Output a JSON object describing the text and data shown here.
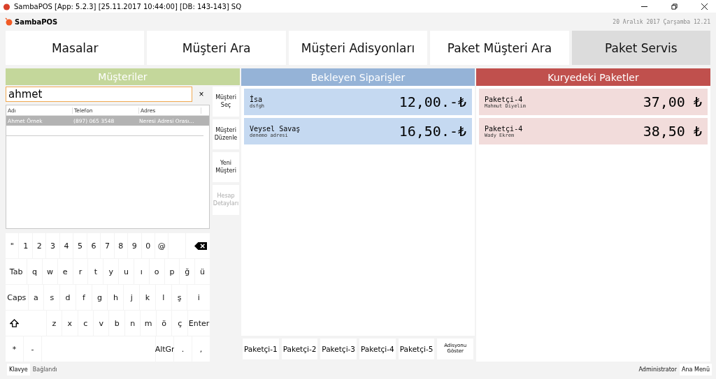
{
  "window": {
    "title": "SambaPOS [App: 5.2.3] [25.11.2017 10:44:00] [DB: 143-143] SQ"
  },
  "header": {
    "logo": "SambaPOS",
    "date": "20 Aralık 2017 Çarşamba 12.21"
  },
  "nav": [
    {
      "label": "Masalar",
      "selected": false
    },
    {
      "label": "Müşteri Ara",
      "selected": false
    },
    {
      "label": "Müşteri Adisyonları",
      "selected": false
    },
    {
      "label": "Paket Müşteri Ara",
      "selected": false
    },
    {
      "label": "Paket Servis",
      "selected": true
    }
  ],
  "customers": {
    "title": "Müşteriler",
    "search": {
      "value": "ahmet",
      "clear": "×"
    },
    "columns": [
      "Adı",
      "Telefon",
      "Adres"
    ],
    "rows": [
      {
        "cells": [
          "Ahmet Örnek",
          "(897) 065 3548",
          "Neresi Adresi Orası..."
        ],
        "selected": true
      }
    ],
    "actions": [
      {
        "label": "Müşteri Seç",
        "disabled": false
      },
      {
        "label": "Müşteri Düzenle",
        "disabled": false
      },
      {
        "label": "Yeni Müşteri",
        "disabled": false
      },
      {
        "label": "Hesap Detayları",
        "disabled": true
      }
    ],
    "keyboard": [
      [
        {
          "kind": "key",
          "label": "\""
        },
        {
          "kind": "key",
          "label": "1"
        },
        {
          "kind": "key",
          "label": "2"
        },
        {
          "kind": "key",
          "label": "3"
        },
        {
          "kind": "key",
          "label": "4"
        },
        {
          "kind": "key",
          "label": "5"
        },
        {
          "kind": "key",
          "label": "6"
        },
        {
          "kind": "key",
          "label": "7"
        },
        {
          "kind": "key",
          "label": "8"
        },
        {
          "kind": "key",
          "label": "9"
        },
        {
          "kind": "key",
          "label": "0"
        },
        {
          "kind": "key",
          "label": "@"
        },
        {
          "kind": "blank"
        },
        {
          "kind": "backspace"
        }
      ],
      [
        {
          "kind": "wide",
          "label": "Tab"
        },
        {
          "kind": "key",
          "label": "q"
        },
        {
          "kind": "key",
          "label": "w"
        },
        {
          "kind": "key",
          "label": "e"
        },
        {
          "kind": "key",
          "label": "r"
        },
        {
          "kind": "key",
          "label": "t"
        },
        {
          "kind": "key",
          "label": "y"
        },
        {
          "kind": "key",
          "label": "u"
        },
        {
          "kind": "key",
          "label": "ı"
        },
        {
          "kind": "key",
          "label": "o"
        },
        {
          "kind": "key",
          "label": "p"
        },
        {
          "kind": "key",
          "label": "ğ"
        },
        {
          "kind": "key",
          "label": "ü"
        }
      ],
      [
        {
          "kind": "wide",
          "label": "Caps"
        },
        {
          "kind": "key",
          "label": "a"
        },
        {
          "kind": "key",
          "label": "s"
        },
        {
          "kind": "key",
          "label": "d"
        },
        {
          "kind": "key",
          "label": "f"
        },
        {
          "kind": "key",
          "label": "g"
        },
        {
          "kind": "key",
          "label": "h"
        },
        {
          "kind": "key",
          "label": "j"
        },
        {
          "kind": "key",
          "label": "k"
        },
        {
          "kind": "key",
          "label": "l"
        },
        {
          "kind": "key",
          "label": "ş"
        },
        {
          "kind": "wide",
          "label": "i"
        }
      ],
      [
        {
          "kind": "shift"
        },
        {
          "kind": "key",
          "label": "z"
        },
        {
          "kind": "key",
          "label": "x"
        },
        {
          "kind": "key",
          "label": "c"
        },
        {
          "kind": "key",
          "label": "v"
        },
        {
          "kind": "key",
          "label": "b"
        },
        {
          "kind": "key",
          "label": "n"
        },
        {
          "kind": "key",
          "label": "m"
        },
        {
          "kind": "key",
          "label": "ö"
        },
        {
          "kind": "key",
          "label": "ç"
        },
        {
          "kind": "wide",
          "label": "Enter"
        }
      ],
      [
        {
          "kind": "key",
          "label": "*"
        },
        {
          "kind": "key",
          "label": "-"
        },
        {
          "kind": "space"
        },
        {
          "kind": "key",
          "label": "AltGr"
        },
        {
          "kind": "key",
          "label": "."
        },
        {
          "kind": "key",
          "label": ","
        }
      ]
    ]
  },
  "waiting": {
    "title": "Bekleyen Siparişler",
    "orders": [
      {
        "name": "İsa",
        "address": "dsfgh",
        "amount": "12,00.-₺"
      },
      {
        "name": "Veysel Savaş",
        "address": "denemo adresi",
        "amount": "16,50.-₺"
      }
    ],
    "couriers": [
      "Paketçi-1",
      "Paketçi-2",
      "Paketçi-3",
      "Paketçi-4",
      "Paketçi-5"
    ],
    "show_button": "Adisyonu Göster"
  },
  "delivering": {
    "title": "Kuryedeki Paketler",
    "orders": [
      {
        "name": "Paketçi-4",
        "address": "Mahmut Diyelim",
        "amount": "37,00 ₺"
      },
      {
        "name": "Paketçi-4",
        "address": "Wady Ekrem",
        "amount": "38,50 ₺"
      }
    ]
  },
  "status_bar": {
    "keyboard_button": "Klavye",
    "connection": "Bağlandı",
    "user": "Administrator",
    "menu_button": "Ana Menü"
  }
}
